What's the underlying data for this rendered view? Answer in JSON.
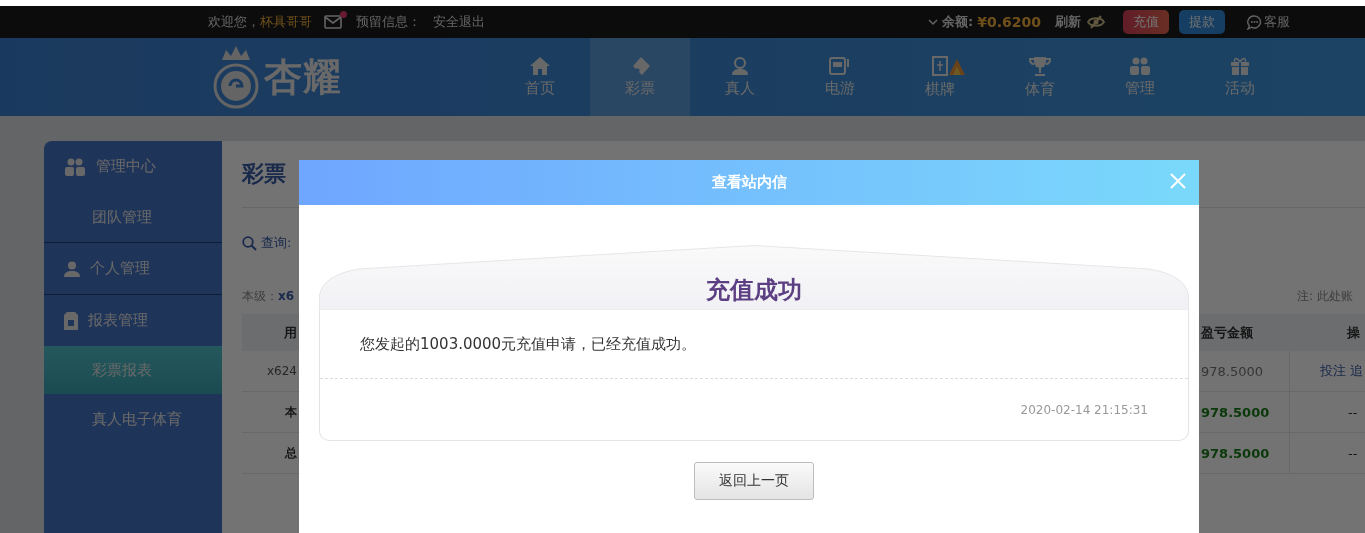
{
  "top_bar": {
    "greeting": "欢迎您，",
    "username": "杯具哥哥",
    "has_unread": true,
    "reserved_label": "预留信息：",
    "logout": "安全退出",
    "balance_label": "余额:",
    "balance": "¥0.6200",
    "refresh": "刷新",
    "recharge": "充值",
    "withdraw": "提款",
    "support": "客服"
  },
  "logo": {
    "text": "杏耀"
  },
  "nav": [
    {
      "label": "首页",
      "selected": false,
      "hot": false
    },
    {
      "label": "彩票",
      "selected": true,
      "hot": false
    },
    {
      "label": "真人",
      "selected": false,
      "hot": false
    },
    {
      "label": "电游",
      "selected": false,
      "hot": false
    },
    {
      "label": "棋牌",
      "selected": false,
      "hot": true
    },
    {
      "label": "体育",
      "selected": false,
      "hot": false
    },
    {
      "label": "管理",
      "selected": false,
      "hot": false
    },
    {
      "label": "活动",
      "selected": false,
      "hot": false
    }
  ],
  "sidebar": [
    {
      "label": "管理中心",
      "children": [
        {
          "label": "团队管理",
          "selected": false
        }
      ]
    },
    {
      "label": "个人管理"
    },
    {
      "label": "报表管理",
      "children": [
        {
          "label": "彩票报表",
          "selected": true
        },
        {
          "label": "真人电子体育",
          "selected": false
        }
      ]
    }
  ],
  "content": {
    "title": "彩票",
    "query_label": "查询:",
    "level_label": "本级：",
    "level_value": "x6",
    "note": "注: 此处账",
    "table": {
      "columns_left": [
        "用"
      ],
      "columns_right": [
        "盈亏金额",
        "操"
      ],
      "rows": [
        {
          "kind": "detail",
          "left": "x624",
          "amount": "978.5000",
          "actions": [
            "投注",
            "追"
          ]
        },
        {
          "kind": "summary",
          "left": "本",
          "amount": "978.5000",
          "actions": [
            "--"
          ]
        },
        {
          "kind": "summary",
          "left": "总",
          "amount": "978.5000",
          "actions": [
            "--"
          ]
        }
      ]
    }
  },
  "modal": {
    "title": "查看站内信",
    "heading": "充值成功",
    "message": "您发起的1003.0000元充值申请，已经充值成功。",
    "date": "2020-02-14 21:15:31",
    "back_button": "返回上一页"
  }
}
